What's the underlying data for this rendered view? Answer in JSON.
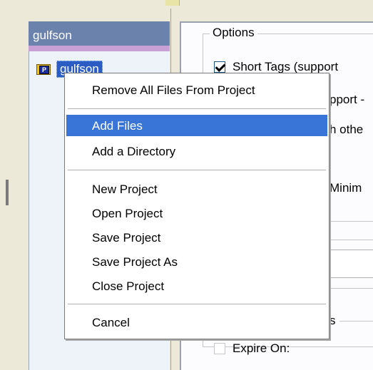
{
  "project_panel": {
    "header": "gulfson",
    "tree": [
      {
        "label": "gulfson",
        "icon": "project-folder-icon"
      }
    ]
  },
  "options": {
    "group_title": "Options",
    "rows": [
      {
        "label": "Short Tags (support",
        "checked": true
      },
      {
        "label": "pport -"
      },
      {
        "label": "h othe"
      },
      {
        "label": "Minim"
      },
      {
        "label": "s"
      },
      {
        "label": "Expire On:",
        "checked": false
      }
    ]
  },
  "context_menu": {
    "items": [
      {
        "label": "Remove All Files From Project"
      },
      {
        "label": "Add Files",
        "highlighted": true
      },
      {
        "label": "Add a Directory"
      },
      {
        "label": "New Project"
      },
      {
        "label": "Open Project"
      },
      {
        "label": "Save Project"
      },
      {
        "label": "Save Project As"
      },
      {
        "label": "Close Project"
      },
      {
        "label": "Cancel"
      }
    ]
  },
  "colors": {
    "highlight": "#3875d7",
    "panel_header": "#6b82ad",
    "selection": "#2b5cc4"
  }
}
